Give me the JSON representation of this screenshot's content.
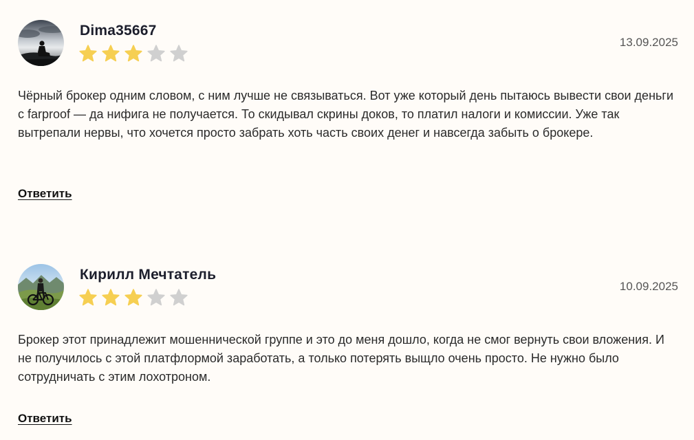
{
  "colors": {
    "star_filled": "#f6cf52",
    "star_empty": "#d0d0d0",
    "background": "#fffcf8"
  },
  "reviews": [
    {
      "author": "Dima35667",
      "date": "13.09.2025",
      "rating": 3,
      "max_rating": 5,
      "text": "Чёрный брокер одним словом, с ним лучше не связываться. Вот уже который день пытаюсь вывести свои деньги с farproof — да нифига не получается. То скидывал скрины доков, то платил налоги и комиссии. Уже так вытрепали нервы, что хочется просто забрать хоть часть своих денег и навсегда забыть о брокере.",
      "reply_label": "Ответить",
      "avatar_icon": "user-avatar-silhouette"
    },
    {
      "author": "Кирилл Мечтатель",
      "date": "10.09.2025",
      "rating": 3,
      "max_rating": 5,
      "text": "Брокер этот принадлежит мошеннической группе и это до меня дошло, когда не смог вернуть свои вложения. И не получилось с этой платфлормой заработать, а только потерять выщло очень просто. Не нужно было сотрудничать с этим лохотроном.",
      "reply_label": "Ответить",
      "avatar_icon": "user-avatar-bicycle"
    }
  ]
}
